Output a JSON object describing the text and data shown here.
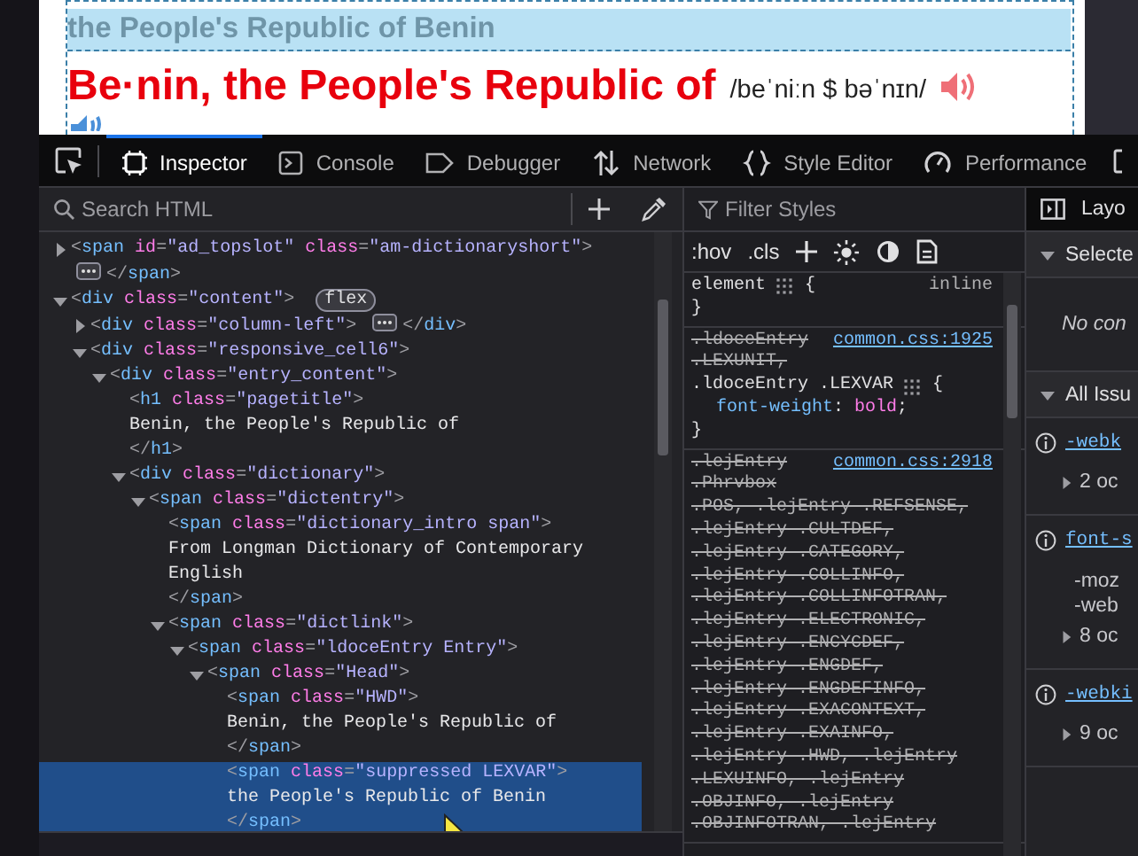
{
  "page": {
    "variant_banner": "the People's Republic of Benin",
    "headword": "Be·nin, the People's Republic of",
    "pronunciation": "/beˈniːn $ bəˈnɪn/"
  },
  "toolbox": {
    "tabs": [
      {
        "kind": "inspector",
        "label": "Inspector",
        "selected": true
      },
      {
        "kind": "console",
        "label": "Console",
        "selected": false
      },
      {
        "kind": "debugger",
        "label": "Debugger",
        "selected": false
      },
      {
        "kind": "network",
        "label": "Network",
        "selected": false
      },
      {
        "kind": "style",
        "label": "Style Editor",
        "selected": false
      },
      {
        "kind": "performance",
        "label": "Performance",
        "selected": false
      }
    ]
  },
  "markup": {
    "search": {
      "placeholder": "Search HTML"
    },
    "nodes": [
      {
        "open": "<span id=\"ad_topslot\" class=\"am-dictionaryshort\">",
        "expanded": false,
        "close": "</span>",
        "selected": false
      },
      {
        "open": "<div class=\"content\">",
        "badge": "flex",
        "expanded": true,
        "selected": false,
        "children": [
          {
            "open": "<div class=\"column-left\">",
            "expanded": false,
            "close": "</div>",
            "selected": false
          },
          {
            "open": "<div class=\"responsive_cell6\">",
            "expanded": true,
            "selected": false,
            "children": [
              {
                "open": "<div class=\"entry_content\">",
                "expanded": true,
                "selected": false,
                "children": [
                  {
                    "open": "<h1 class=\"pagetitle\">",
                    "text": "Benin, the People's Republic of",
                    "close": "</h1>",
                    "selected": false
                  },
                  {
                    "open": "<div class=\"dictionary\">",
                    "expanded": true,
                    "selected": false,
                    "children": [
                      {
                        "open": "<span class=\"dictentry\">",
                        "expanded": true,
                        "selected": false,
                        "children": [
                          {
                            "open": "<span class=\"dictionary_intro span\">",
                            "text": "From Longman Dictionary of Contemporary English",
                            "close": "</span>",
                            "selected": false
                          },
                          {
                            "open": "<span class=\"dictlink\">",
                            "expanded": true,
                            "selected": false,
                            "children": [
                              {
                                "open": "<span class=\"ldoceEntry Entry\">",
                                "expanded": true,
                                "selected": false,
                                "children": [
                                  {
                                    "open": "<span class=\"Head\">",
                                    "expanded": true,
                                    "selected": false,
                                    "children": [
                                      {
                                        "open": "<span class=\"HWD\">",
                                        "text": "Benin, the People's Republic of",
                                        "close": "</span>",
                                        "selected": false
                                      },
                                      {
                                        "open": "<span class=\"suppressed LEXVAR\">",
                                        "text": "the People's Republic of Benin",
                                        "close": "</span>",
                                        "selected": true
                                      }
                                    ]
                                  }
                                ]
                              }
                            ]
                          }
                        ]
                      }
                    ]
                  }
                ]
              }
            ]
          }
        ]
      }
    ]
  },
  "rules": {
    "filter": {
      "placeholder": "Filter Styles"
    },
    "pseudo_toggles": [
      ":hov",
      ".cls"
    ],
    "rules": [
      {
        "source_is_link": false,
        "source": "inline",
        "selectors": [
          {
            "text": "element",
            "overridden": false,
            "grid_icon": true,
            "suffix": "{"
          }
        ],
        "close": "}"
      },
      {
        "source_is_link": true,
        "source": "common.css:1925",
        "selectors": [
          {
            "text": ".ldoceEntry",
            "overridden": true
          },
          {
            "text": ".LEXUNIT,",
            "overridden": true
          },
          {
            "text": ".ldoceEntry .LEXVAR",
            "overridden": false,
            "grid_icon": true,
            "suffix": "{"
          }
        ],
        "declarations": [
          "font-weight: bold;"
        ],
        "close": "}"
      },
      {
        "source_is_link": true,
        "source": "common.css:2918",
        "selectors": [
          {
            "text": ".lejEntry",
            "overridden": true
          },
          {
            "text": ".Phrvbox",
            "overridden": true
          },
          {
            "text": ".POS, .lejEntry .REFSENSE,",
            "overridden": true
          },
          {
            "text": ".lejEntry .CULTDEF,",
            "overridden": true
          },
          {
            "text": ".lejEntry .CATEGORY,",
            "overridden": true
          },
          {
            "text": ".lejEntry .COLLINFO,",
            "overridden": true
          },
          {
            "text": ".lejEntry .COLLINFOTRAN,",
            "overridden": true
          },
          {
            "text": ".lejEntry .ELECTRONIC,",
            "overridden": true
          },
          {
            "text": ".lejEntry .ENCYCDEF,",
            "overridden": true
          },
          {
            "text": ".lejEntry .ENGDEF,",
            "overridden": true
          },
          {
            "text": ".lejEntry .ENGDEFINFO,",
            "overridden": true
          },
          {
            "text": ".lejEntry .EXACONTEXT,",
            "overridden": true
          },
          {
            "text": ".lejEntry .EXAINFO,",
            "overridden": true
          },
          {
            "text": ".lejEntry .HWD, .lejEntry",
            "overridden": true
          },
          {
            "text": ".LEXUINFO, .lejEntry",
            "overridden": true
          },
          {
            "text": ".OBJINFO, .lejEntry",
            "overridden": true
          },
          {
            "text": ".OBJINFOTRAN, .lejEntry",
            "overridden": true
          }
        ]
      }
    ]
  },
  "sidebar": {
    "tab": "Layo",
    "selected_section": {
      "title": "Selecte",
      "expanded": true,
      "empty_message": "No con"
    },
    "issues_section": {
      "title": "All Issu",
      "expanded": true,
      "issues": [
        {
          "property": "-webk",
          "occurrences": "2 oc",
          "expanded": false
        },
        {
          "property": "font-s",
          "lines": [
            "-moz",
            "-web"
          ],
          "occurrences": "8 oc",
          "expanded": false
        },
        {
          "property": "-webki",
          "occurrences": "9 oc",
          "expanded": false
        }
      ]
    }
  }
}
